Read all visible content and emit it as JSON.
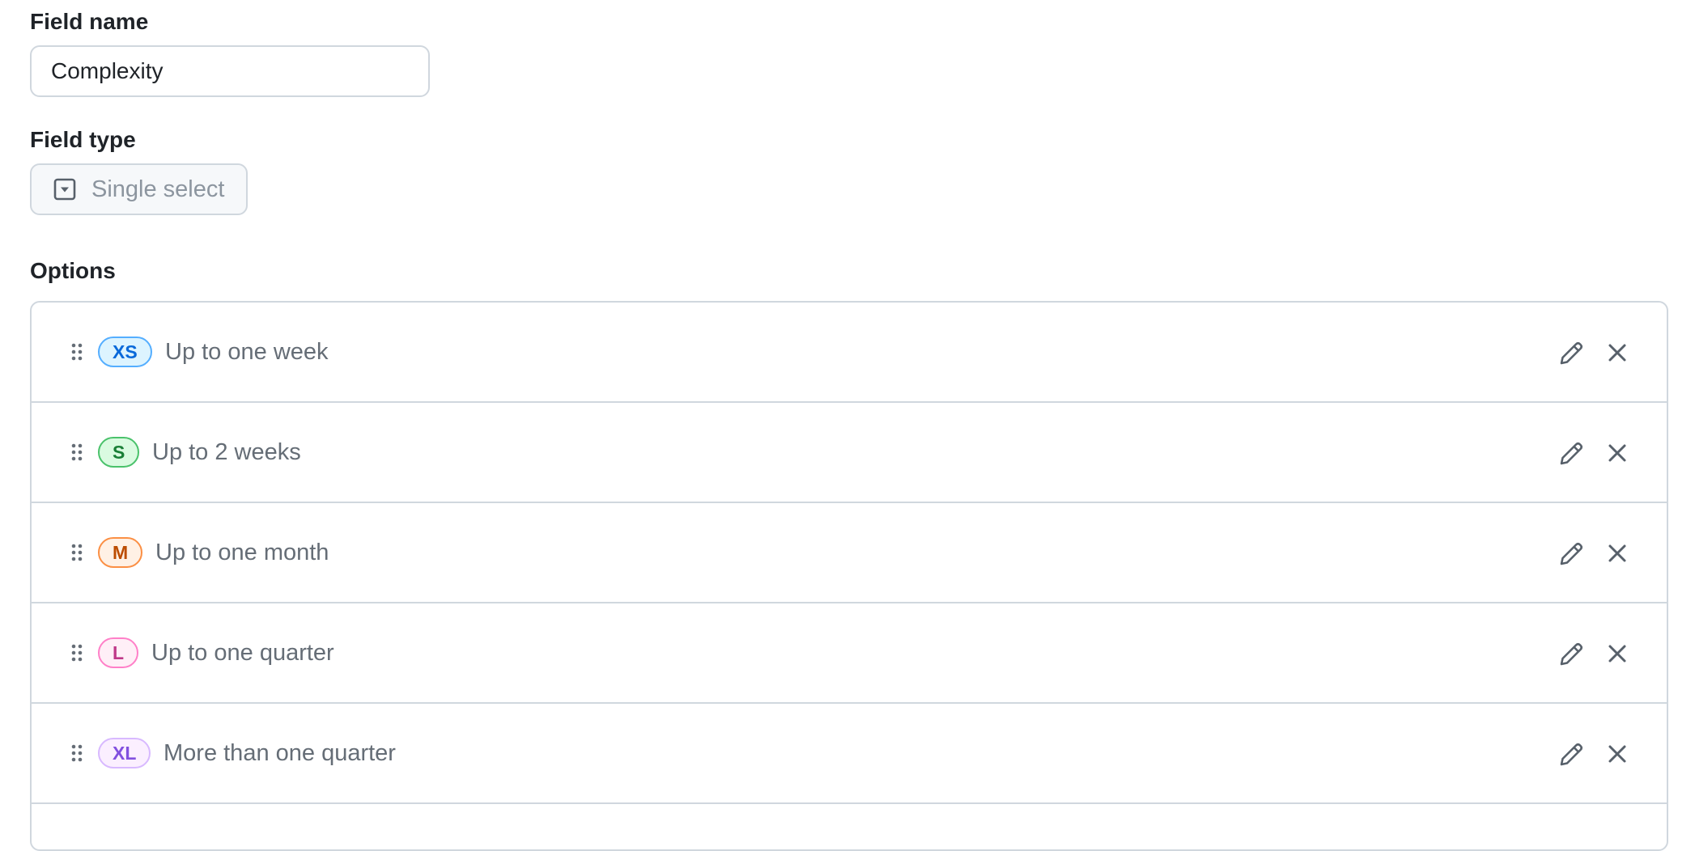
{
  "field_name": {
    "label": "Field name",
    "value": "Complexity"
  },
  "field_type": {
    "label": "Field type",
    "value": "Single select",
    "icon": "single-select-icon"
  },
  "options": {
    "label": "Options",
    "items": [
      {
        "badge": "XS",
        "text": "Up to one week",
        "badge_bg": "#ddf4ff",
        "badge_border": "#54aeff",
        "badge_color": "#0969da"
      },
      {
        "badge": "S",
        "text": "Up to 2 weeks",
        "badge_bg": "#dafbe1",
        "badge_border": "#4ac26b",
        "badge_color": "#1a7f37"
      },
      {
        "badge": "M",
        "text": "Up to one month",
        "badge_bg": "#fff1e5",
        "badge_border": "#fb8f44",
        "badge_color": "#bc4c00"
      },
      {
        "badge": "L",
        "text": "Up to one quarter",
        "badge_bg": "#ffeff7",
        "badge_border": "#ff80c8",
        "badge_color": "#bf3989"
      },
      {
        "badge": "XL",
        "text": "More than one quarter",
        "badge_bg": "#fbefff",
        "badge_border": "#d8b9ff",
        "badge_color": "#8250df"
      }
    ]
  }
}
